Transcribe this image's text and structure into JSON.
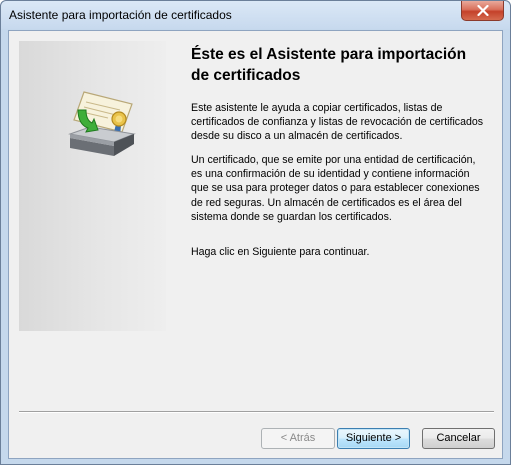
{
  "window": {
    "title": "Asistente para importación de certificados"
  },
  "content": {
    "heading_line1": "Éste es el Asistente para importación",
    "heading_line2": "de certificados",
    "paragraph1": "Este asistente le ayuda a copiar certificados, listas de certificados de confianza y listas de revocación de certificados desde su disco a un almacén de certificados.",
    "paragraph2": "Un certificado, que se emite por una entidad de certificación, es una confirmación de su identidad y contiene información que se usa para proteger datos o para establecer conexiones de red seguras. Un almacén de certificados es el área del sistema donde se guardan los certificados.",
    "paragraph3": "Haga clic en Siguiente para continuar."
  },
  "buttons": {
    "back": {
      "label": "< Atrás",
      "enabled": false
    },
    "next": {
      "label": "Siguiente >",
      "enabled": true,
      "default": true
    },
    "cancel": {
      "label": "Cancelar",
      "enabled": true
    }
  },
  "icons": {
    "close": "close-icon",
    "wizard": "certificate-import-icon"
  },
  "colors": {
    "close_button": "#c4412a",
    "frame": "#c5d8ec",
    "client_bg": "#f0f0f0",
    "next_button_border": "#3c7fb1"
  }
}
